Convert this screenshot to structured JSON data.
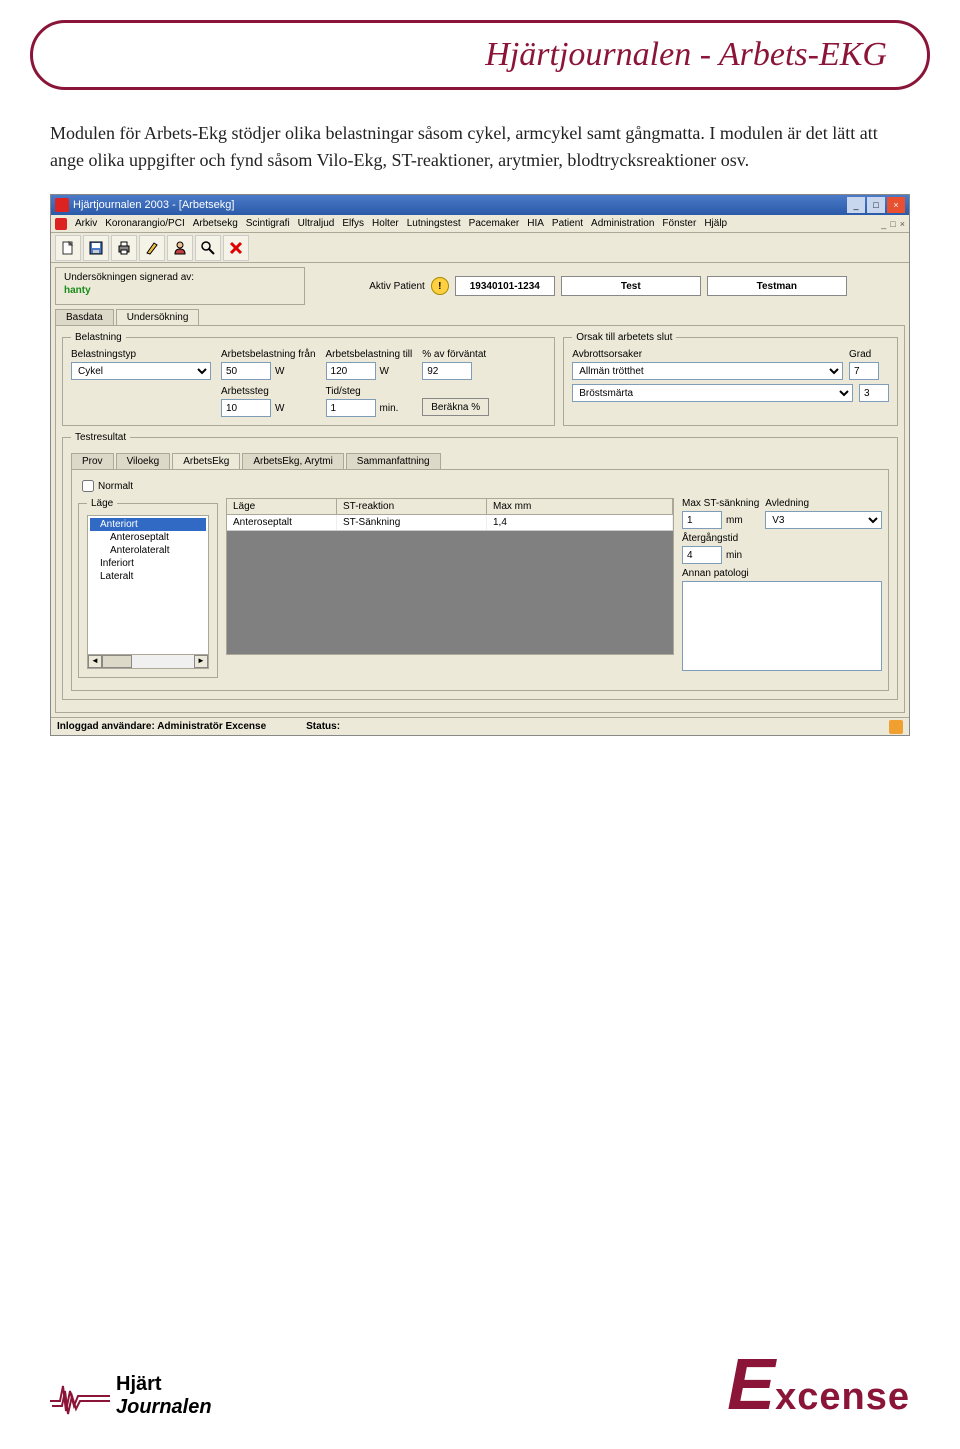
{
  "page": {
    "title": "Hjärtjournalen - Arbets-EKG",
    "paragraph": "Modulen för Arbets-Ekg stödjer olika belastningar såsom cykel, armcykel samt gångmatta. I modulen är det lätt att ange olika uppgifter och fynd såsom Vilo-Ekg, ST-reaktioner, arytmier, blodtrycksreaktioner osv."
  },
  "app": {
    "title": "Hjärtjournalen 2003 - [Arbetsekg]",
    "menus": [
      "Arkiv",
      "Koronarangio/PCI",
      "Arbetsekg",
      "Scintigrafi",
      "Ultraljud",
      "Elfys",
      "Holter",
      "Lutningstest",
      "Pacemaker",
      "HIA",
      "Patient",
      "Administration",
      "Fönster",
      "Hjälp"
    ],
    "signed_label": "Undersökningen signerad av:",
    "signed_by": "hanty",
    "active_patient_label": "Aktiv Patient",
    "patient_id": "19340101-1234",
    "patient_last": "Test",
    "patient_first": "Testman",
    "tabs_main": [
      "Basdata",
      "Undersökning"
    ],
    "belastning": {
      "legend": "Belastning",
      "type_label": "Belastningstyp",
      "type_value": "Cykel",
      "from_label": "Arbetsbelastning från",
      "from_value": "50",
      "to_label": "Arbetsbelastning till",
      "to_value": "120",
      "pct_label": "% av förväntat",
      "pct_value": "92",
      "step_label": "Arbetssteg",
      "step_value": "10",
      "time_label": "Tid/steg",
      "time_value": "1",
      "unit_w": "W",
      "unit_min": "min.",
      "calc_btn": "Beräkna %"
    },
    "orsak": {
      "legend": "Orsak till arbetets slut",
      "avbrott_label": "Avbrottsorsaker",
      "grad_label": "Grad",
      "row1": "Allmän trötthet",
      "row1_grad": "7",
      "row2": "Bröstsmärta",
      "row2_grad": "3"
    },
    "testresultat": {
      "legend": "Testresultat",
      "tabs": [
        "Prov",
        "Viloekg",
        "ArbetsEkg",
        "ArbetsEkg, Arytmi",
        "Sammanfattning"
      ],
      "normalt": "Normalt",
      "lage_legend": "Läge",
      "tree": [
        "Anteriort",
        "Anteroseptalt",
        "Anterolateralt",
        "Inferiort",
        "Lateralt"
      ],
      "grid_headers": [
        "Läge",
        "ST-reaktion",
        "Max mm"
      ],
      "grid_row": [
        "Anteroseptalt",
        "ST-Sänkning",
        "1,4"
      ],
      "maxst_label": "Max ST-sänkning",
      "maxst_value": "1",
      "maxst_unit": "mm",
      "avl_label": "Avledning",
      "avl_value": "V3",
      "atergang_label": "Återgångstid",
      "atergang_value": "4",
      "atergang_unit": "min",
      "annan_label": "Annan patologi"
    },
    "status": {
      "user": "Inloggad användare: Administratör Excense",
      "status": "Status:"
    }
  },
  "footer": {
    "logo1a": "Hjärt",
    "logo1b": "Journalen",
    "logo2": "xcense"
  }
}
